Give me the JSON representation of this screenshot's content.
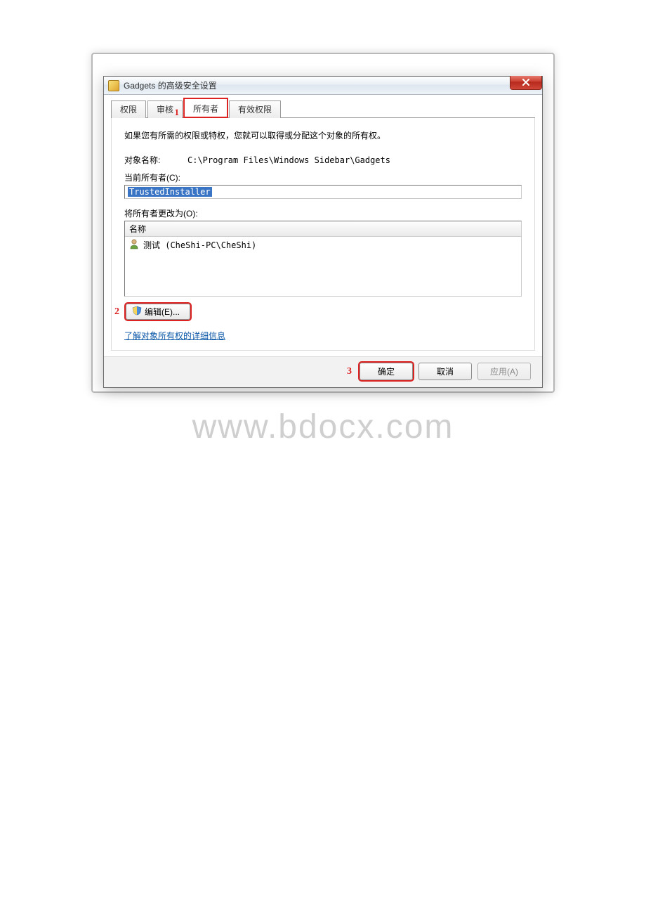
{
  "window": {
    "title": "Gadgets 的高级安全设置"
  },
  "tabs": {
    "permissions": "权限",
    "auditing": "审核",
    "owner": "所有者",
    "effective": "有效权限"
  },
  "annotations": {
    "tab": "1",
    "edit": "2",
    "ok": "3"
  },
  "content": {
    "desc": "如果您有所需的权限或特权，您就可以取得或分配这个对象的所有权。",
    "object_label": "对象名称:",
    "object_path": "C:\\Program Files\\Windows Sidebar\\Gadgets",
    "current_owner_label": "当前所有者(C):",
    "current_owner_value": "TrustedInstaller",
    "change_owner_label": "将所有者更改为(O):",
    "list_header": "名称",
    "list_entry": "测试 (CheShi-PC\\CheShi)",
    "edit_button": "编辑(E)...",
    "learn_link": "了解对象所有权的详细信息"
  },
  "buttons": {
    "ok": "确定",
    "cancel": "取消",
    "apply": "应用(A)"
  },
  "watermark": "www.bdocx.com"
}
